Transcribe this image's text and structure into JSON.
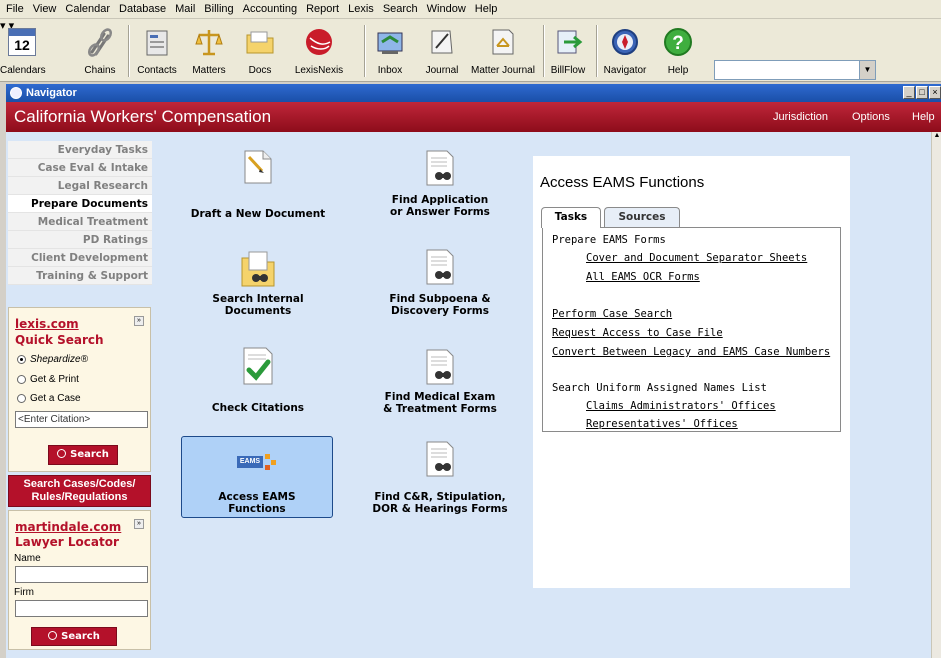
{
  "menu": [
    "File",
    "View",
    "Calendar",
    "Database",
    "Mail",
    "Billing",
    "Accounting",
    "Report",
    "Lexis",
    "Search",
    "Window",
    "Help"
  ],
  "toolbar": {
    "calendar_day": "12",
    "buttons": {
      "calendars": "Calendars",
      "chains": "Chains",
      "contacts": "Contacts",
      "matters": "Matters",
      "docs": "Docs",
      "lexisnexis": "LexisNexis",
      "inbox": "Inbox",
      "journal": "Journal",
      "matter_journal": "Matter Journal",
      "billflow": "BillFlow",
      "navigator": "Navigator",
      "help": "Help"
    },
    "combo_value": ""
  },
  "window": {
    "title": "Navigator",
    "controls": [
      "_",
      "□",
      "×"
    ]
  },
  "header": {
    "title": "California Workers' Compensation",
    "links": [
      "Jurisdiction",
      "Options",
      "Help"
    ]
  },
  "sidebar": {
    "items": [
      "Everyday Tasks",
      "Case Eval & Intake",
      "Legal Research",
      "Prepare Documents",
      "Medical Treatment",
      "PD Ratings",
      "Client Development",
      "Training & Support"
    ],
    "active_index": 3
  },
  "quick_search": {
    "brand": "lexis.com",
    "title": "Quick Search",
    "options": [
      "Shepardize®",
      "Get & Print",
      "Get a Case"
    ],
    "selected": 0,
    "input_value": "<Enter Citation>",
    "button": "Search"
  },
  "search_codes_button": "Search Cases/Codes/ Rules/Regulations",
  "lawyer_locator": {
    "brand": "martindale.com",
    "title": "Lawyer Locator",
    "name_label": "Name",
    "name_value": "",
    "firm_label": "Firm",
    "firm_value": "",
    "button": "Search"
  },
  "documents": {
    "draft": "Draft a New Document",
    "find_app": "Find Application\nor Answer Forms",
    "search_internal": "Search Internal\nDocuments",
    "find_subpoena": "Find Subpoena &\nDiscovery Forms",
    "check_citations": "Check Citations",
    "find_medical": "Find Medical Exam\n& Treatment Forms",
    "access_eams": "Access EAMS\nFunctions",
    "find_cr": "Find C&R, Stipulation,\nDOR & Hearings Forms",
    "eams_logo_text": "EAMS"
  },
  "eams_panel": {
    "title": "Access EAMS Functions",
    "tabs": [
      "Tasks",
      "Sources"
    ],
    "active_tab": 0,
    "section1": "Prepare EAMS Forms",
    "link_cover": "Cover and Document Separator Sheets",
    "link_ocr": "All EAMS OCR Forms",
    "link_case_search": "Perform Case Search",
    "link_request": "Request Access to Case File",
    "link_convert": "Convert Between Legacy and EAMS Case Numbers",
    "section2": "Search Uniform Assigned Names List",
    "link_claims": "Claims Administrators' Offices",
    "link_reps": "Representatives' Offices"
  }
}
